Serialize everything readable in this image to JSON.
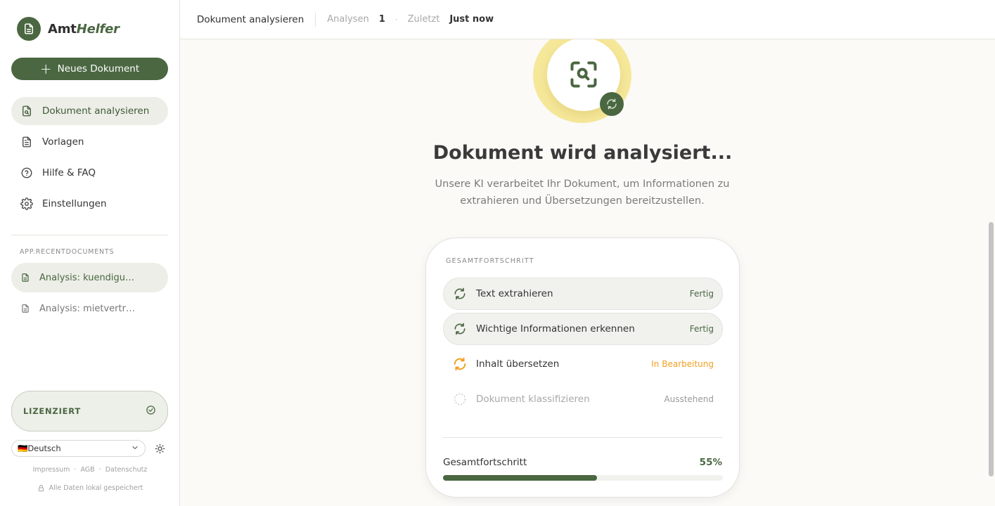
{
  "brand": {
    "name_plain": "Amt",
    "name_accent": "Helfer"
  },
  "sidebar": {
    "new_document": "Neues Dokument",
    "items": [
      {
        "label": "Dokument analysieren",
        "icon": "file-search-icon",
        "active": true
      },
      {
        "label": "Vorlagen",
        "icon": "file-text-icon",
        "active": false
      },
      {
        "label": "Hilfe & FAQ",
        "icon": "help-circle-icon",
        "active": false
      },
      {
        "label": "Einstellungen",
        "icon": "gear-icon",
        "active": false
      }
    ],
    "recent_label": "APP.RECENTDOCUMENTS",
    "recent": [
      {
        "label": "Analysis: kuendigung.pdf",
        "active": true
      },
      {
        "label": "Analysis: mietvertrag.pdf",
        "active": false
      }
    ],
    "license": {
      "label": "LIZENZIERT"
    },
    "language": {
      "flag": "🇩🇪",
      "selected": "Deutsch"
    },
    "footer": {
      "impressum": "Impressum",
      "agb": "AGB",
      "datenschutz": "Datenschutz",
      "local_note": "Alle Daten lokal gespeichert"
    }
  },
  "header": {
    "title": "Dokument analysieren",
    "analyses_label": "Analysen",
    "analyses_value": "1",
    "last_label": "Zuletzt",
    "last_value": "Just now"
  },
  "main": {
    "heading": "Dokument wird analysiert...",
    "subtext": "Unsere KI verarbeitet Ihr Dokument, um Informationen zu extrahieren und Übersetzungen bereitzustellen.",
    "card": {
      "label": "GESAMTFORTSCHRITT",
      "steps": [
        {
          "name": "Text extrahieren",
          "status": "Fertig",
          "state": "done"
        },
        {
          "name": "Wichtige Informationen erkennen",
          "status": "Fertig",
          "state": "done"
        },
        {
          "name": "Inhalt übersetzen",
          "status": "In Bearbeitung",
          "state": "progress"
        },
        {
          "name": "Dokument klassifizieren",
          "status": "Ausstehend",
          "state": "pending"
        }
      ],
      "total_label": "Gesamtfortschritt",
      "total_value": "55%",
      "progress": 55
    }
  },
  "colors": {
    "accent": "#4a6741",
    "in_progress": "#f0a020",
    "ring": "#f6e89a"
  }
}
